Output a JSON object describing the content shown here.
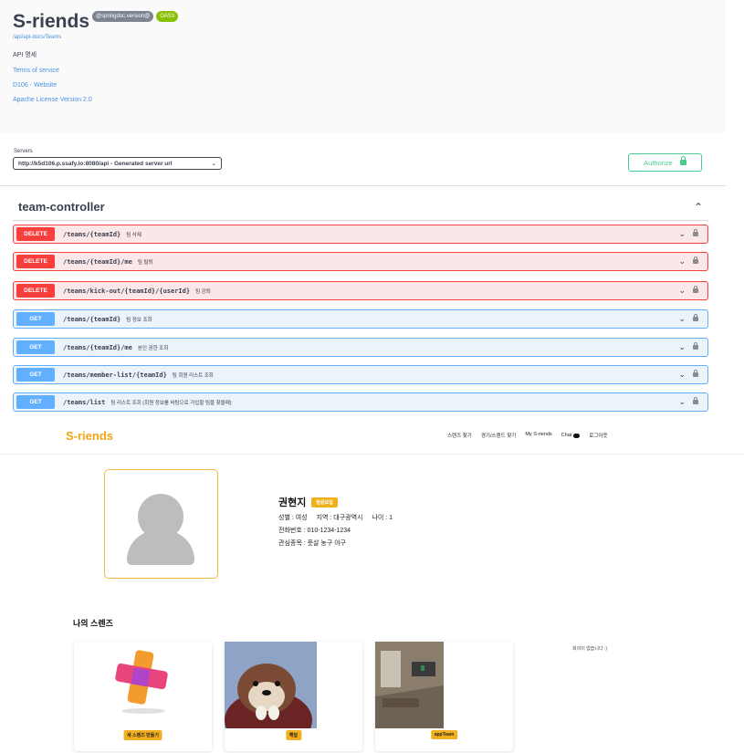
{
  "swagger": {
    "title": "S-riends",
    "version_badge": "@springdoc.version@",
    "oas_badge": "OAS3",
    "api_url": "/api/api-docs/Teams",
    "description": "API 명세",
    "links": [
      "Terms of service",
      "D106 - Website",
      "Apache License Version 2.0"
    ],
    "servers_label": "Servers",
    "server_value": "http://k5d106.p.ssafy.io:8080/api - Generated server url",
    "authorize_label": "Authorize",
    "tag_name": "team-controller",
    "operations": [
      {
        "method": "DELETE",
        "path": "/teams/{teamId}",
        "summary": "팀 삭제"
      },
      {
        "method": "DELETE",
        "path": "/teams/{teamId}/me",
        "summary": "팀 탈퇴"
      },
      {
        "method": "DELETE",
        "path": "/teams/kick-out/{teamId}/{userId}",
        "summary": "팀 강퇴"
      },
      {
        "method": "GET",
        "path": "/teams/{teamId}",
        "summary": "팀 정보 조회"
      },
      {
        "method": "GET",
        "path": "/teams/{teamId}/me",
        "summary": "본인 권한 조회"
      },
      {
        "method": "GET",
        "path": "/teams/member-list/{teamId}",
        "summary": "팀 회원 리스트 조회"
      },
      {
        "method": "GET",
        "path": "/teams/list",
        "summary": "팀 리스트 조회 (회원 정보를 바탕으로 가입할 팀을 찾을때)"
      }
    ]
  },
  "app": {
    "brand": "S-riends",
    "menu": [
      "스렌즈 찾기",
      "경기/스렌드 찾기",
      "My S-riends",
      "Chat",
      "로그아웃"
    ],
    "profile": {
      "name": "권현지",
      "badge": "팀원모집",
      "gender": "성별 : 여성",
      "region": "지역 : 대구광역시",
      "age": "나이 : 1",
      "phone": "전화번호 : 010-1234-1234",
      "interests": "관심종목 : 풋살 농구 야구"
    },
    "section_title": "나의 스렌즈",
    "cards": [
      "새 스렌즈 만들기",
      "해달",
      "appTeam"
    ],
    "empty_note": "회의이 없습니다 :)"
  },
  "colors": {
    "delete": "#f93e3e",
    "get": "#61affe",
    "authorize": "#49cc90",
    "brand": "#f2a516"
  }
}
